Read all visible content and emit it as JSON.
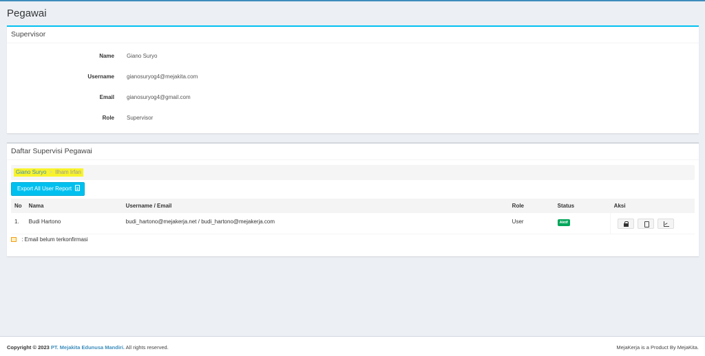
{
  "page": {
    "title": "Pegawai"
  },
  "supervisor_box": {
    "title": "Supervisor",
    "fields": [
      {
        "label": "Name",
        "value": "Giano Suryo"
      },
      {
        "label": "Username",
        "value": "gianosuryog4@mejakita.com"
      },
      {
        "label": "Email",
        "value": "gianosuryog4@gmail.com"
      },
      {
        "label": "Role",
        "value": "Supervisor"
      }
    ]
  },
  "list_box": {
    "title": "Daftar Supervisi Pegawai",
    "breadcrumb": {
      "link": "Giano Suryo",
      "separator": ">",
      "active": "Ilham Irfan"
    },
    "export_label": "Export All User Report",
    "columns": [
      "No",
      "Nama",
      "Username / Email",
      "Role",
      "Status",
      "Aksi"
    ],
    "rows": [
      {
        "no": "1.",
        "nama": "Budi Hartono",
        "username_email": "budi_hartono@mejakerja.net / budi_hartono@mejakerja.com",
        "role": "User",
        "status": "Aktif"
      }
    ],
    "legend": ": Email belum terkonfirmasi"
  },
  "colors": {
    "accent": "#00c0ef",
    "primary": "#3c8dbc",
    "success": "#00a65a",
    "highlight": "#f8f32b"
  },
  "footer": {
    "copyright": "Copyright © 2023",
    "company": "PT. Mejakita Edunusa Mandiri.",
    "rights": "All rights reserved.",
    "right_text": "MejaKerja is a Product By MejaKita."
  }
}
